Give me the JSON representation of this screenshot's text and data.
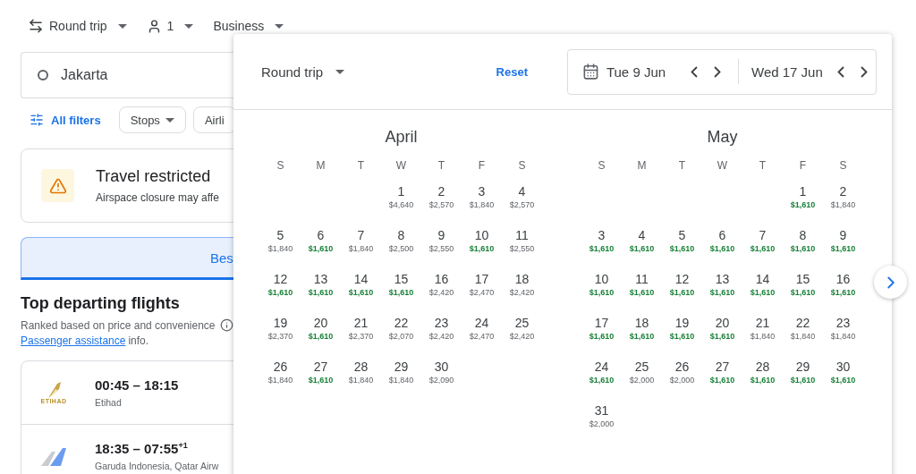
{
  "trip_bar": {
    "trip_type": "Round trip",
    "passengers": "1",
    "cabin": "Business"
  },
  "origin": {
    "value": "Jakarta"
  },
  "filters": {
    "all_filters": "All filters",
    "chips": [
      "Stops",
      "Airli"
    ]
  },
  "alert": {
    "title": "Travel restricted",
    "text": "Airspace closure may affe"
  },
  "sort_tabs": [
    {
      "label": "Bes",
      "selected": true
    }
  ],
  "flights_section": {
    "title": "Top departing flights",
    "subtitle": "Ranked based on price and convenience",
    "link": "Passenger assistance",
    "link_suffix": "info."
  },
  "flights": [
    {
      "kind": "wordmark",
      "logo_text": "ETIHAD",
      "times": "00:45 – 18:15",
      "airline": "Etihad"
    },
    {
      "kind": "tail",
      "times": "18:35 – 07:55$^{+1}$",
      "airline": "Garuda Indonesia, Qatar Airw"
    }
  ],
  "date_picker": {
    "trip_type": "Round trip",
    "reset": "Reset",
    "departure": "Tue 9 Jun",
    "return": "Wed 17 Jun",
    "months": [
      {
        "name": "April",
        "weekdays": [
          "S",
          "M",
          "T",
          "W",
          "T",
          "F",
          "S"
        ],
        "weeks": [
          [
            {
              "kind": "blank"
            },
            {
              "kind": "blank"
            },
            {
              "kind": "blank"
            },
            {
              "day": "1",
              "price": "$4,640",
              "cheap": false
            },
            {
              "day": "2",
              "price": "$2,570",
              "cheap": false
            },
            {
              "day": "3",
              "price": "$1,840",
              "cheap": false
            },
            {
              "day": "4",
              "price": "$2,570",
              "cheap": false
            }
          ],
          [
            {
              "day": "5",
              "price": "$1,840",
              "cheap": false
            },
            {
              "day": "6",
              "price": "$1,610",
              "cheap": true
            },
            {
              "day": "7",
              "price": "$1,840",
              "cheap": false
            },
            {
              "day": "8",
              "price": "$2,500",
              "cheap": false
            },
            {
              "day": "9",
              "price": "$2,550",
              "cheap": false
            },
            {
              "day": "10",
              "price": "$1,610",
              "cheap": true
            },
            {
              "day": "11",
              "price": "$2,550",
              "cheap": false
            }
          ],
          [
            {
              "day": "12",
              "price": "$1,610",
              "cheap": true
            },
            {
              "day": "13",
              "price": "$1,610",
              "cheap": true
            },
            {
              "day": "14",
              "price": "$1,610",
              "cheap": true
            },
            {
              "day": "15",
              "price": "$1,610",
              "cheap": true
            },
            {
              "day": "16",
              "price": "$2,420",
              "cheap": false
            },
            {
              "day": "17",
              "price": "$2,470",
              "cheap": false
            },
            {
              "day": "18",
              "price": "$2,420",
              "cheap": false
            }
          ],
          [
            {
              "day": "19",
              "price": "$2,370",
              "cheap": false
            },
            {
              "day": "20",
              "price": "$1,610",
              "cheap": true
            },
            {
              "day": "21",
              "price": "$2,370",
              "cheap": false
            },
            {
              "day": "22",
              "price": "$2,070",
              "cheap": false
            },
            {
              "day": "23",
              "price": "$2,420",
              "cheap": false
            },
            {
              "day": "24",
              "price": "$2,470",
              "cheap": false
            },
            {
              "day": "25",
              "price": "$2,420",
              "cheap": false
            }
          ],
          [
            {
              "day": "26",
              "price": "$1,840",
              "cheap": false
            },
            {
              "day": "27",
              "price": "$1,610",
              "cheap": true
            },
            {
              "day": "28",
              "price": "$1,840",
              "cheap": false
            },
            {
              "day": "29",
              "price": "$1,840",
              "cheap": false
            },
            {
              "day": "30",
              "price": "$2,090",
              "cheap": false
            },
            {
              "kind": "blank"
            },
            {
              "kind": "blank"
            }
          ]
        ]
      },
      {
        "name": "May",
        "weekdays": [
          "S",
          "M",
          "T",
          "W",
          "T",
          "F",
          "S"
        ],
        "weeks": [
          [
            {
              "kind": "blank"
            },
            {
              "kind": "blank"
            },
            {
              "kind": "blank"
            },
            {
              "kind": "blank"
            },
            {
              "kind": "blank"
            },
            {
              "day": "1",
              "price": "$1,610",
              "cheap": true
            },
            {
              "day": "2",
              "price": "$1,840",
              "cheap": false
            }
          ],
          [
            {
              "day": "3",
              "price": "$1,610",
              "cheap": true
            },
            {
              "day": "4",
              "price": "$1,610",
              "cheap": true
            },
            {
              "day": "5",
              "price": "$1,610",
              "cheap": true
            },
            {
              "day": "6",
              "price": "$1,610",
              "cheap": true
            },
            {
              "day": "7",
              "price": "$1,610",
              "cheap": true
            },
            {
              "day": "8",
              "price": "$1,610",
              "cheap": true
            },
            {
              "day": "9",
              "price": "$1,610",
              "cheap": true
            }
          ],
          [
            {
              "day": "10",
              "price": "$1,610",
              "cheap": true
            },
            {
              "day": "11",
              "price": "$1,610",
              "cheap": true
            },
            {
              "day": "12",
              "price": "$1,610",
              "cheap": true
            },
            {
              "day": "13",
              "price": "$1,610",
              "cheap": true
            },
            {
              "day": "14",
              "price": "$1,610",
              "cheap": true
            },
            {
              "day": "15",
              "price": "$1,610",
              "cheap": true
            },
            {
              "day": "16",
              "price": "$1,610",
              "cheap": true
            }
          ],
          [
            {
              "day": "17",
              "price": "$1,610",
              "cheap": true
            },
            {
              "day": "18",
              "price": "$1,610",
              "cheap": true
            },
            {
              "day": "19",
              "price": "$1,610",
              "cheap": true
            },
            {
              "day": "20",
              "price": "$1,610",
              "cheap": true
            },
            {
              "day": "21",
              "price": "$1,840",
              "cheap": false
            },
            {
              "day": "22",
              "price": "$1,840",
              "cheap": false
            },
            {
              "day": "23",
              "price": "$1,840",
              "cheap": false
            }
          ],
          [
            {
              "day": "24",
              "price": "$1,610",
              "cheap": true
            },
            {
              "day": "25",
              "price": "$2,000",
              "cheap": false
            },
            {
              "day": "26",
              "price": "$2,000",
              "cheap": false
            },
            {
              "day": "27",
              "price": "$1,610",
              "cheap": true
            },
            {
              "day": "28",
              "price": "$1,610",
              "cheap": true
            },
            {
              "day": "29",
              "price": "$1,610",
              "cheap": true
            },
            {
              "day": "30",
              "price": "$1,610",
              "cheap": true
            }
          ],
          [
            {
              "day": "31",
              "price": "$2,000",
              "cheap": false
            },
            {
              "kind": "blank"
            },
            {
              "kind": "blank"
            },
            {
              "kind": "blank"
            },
            {
              "kind": "blank"
            },
            {
              "kind": "blank"
            },
            {
              "kind": "blank"
            }
          ]
        ]
      }
    ]
  }
}
